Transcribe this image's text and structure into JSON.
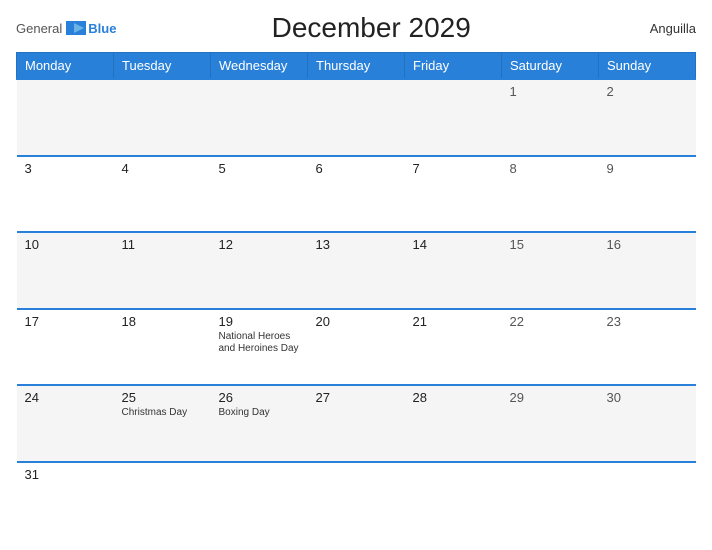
{
  "header": {
    "logo_general": "General",
    "logo_blue": "Blue",
    "title": "December 2029",
    "country": "Anguilla"
  },
  "columns": [
    "Monday",
    "Tuesday",
    "Wednesday",
    "Thursday",
    "Friday",
    "Saturday",
    "Sunday"
  ],
  "weeks": [
    [
      {
        "day": "",
        "holiday": ""
      },
      {
        "day": "",
        "holiday": ""
      },
      {
        "day": "",
        "holiday": ""
      },
      {
        "day": "",
        "holiday": ""
      },
      {
        "day": "",
        "holiday": ""
      },
      {
        "day": "1",
        "holiday": ""
      },
      {
        "day": "2",
        "holiday": ""
      }
    ],
    [
      {
        "day": "3",
        "holiday": ""
      },
      {
        "day": "4",
        "holiday": ""
      },
      {
        "day": "5",
        "holiday": ""
      },
      {
        "day": "6",
        "holiday": ""
      },
      {
        "day": "7",
        "holiday": ""
      },
      {
        "day": "8",
        "holiday": ""
      },
      {
        "day": "9",
        "holiday": ""
      }
    ],
    [
      {
        "day": "10",
        "holiday": ""
      },
      {
        "day": "11",
        "holiday": ""
      },
      {
        "day": "12",
        "holiday": ""
      },
      {
        "day": "13",
        "holiday": ""
      },
      {
        "day": "14",
        "holiday": ""
      },
      {
        "day": "15",
        "holiday": ""
      },
      {
        "day": "16",
        "holiday": ""
      }
    ],
    [
      {
        "day": "17",
        "holiday": ""
      },
      {
        "day": "18",
        "holiday": ""
      },
      {
        "day": "19",
        "holiday": "National Heroes and Heroines Day"
      },
      {
        "day": "20",
        "holiday": ""
      },
      {
        "day": "21",
        "holiday": ""
      },
      {
        "day": "22",
        "holiday": ""
      },
      {
        "day": "23",
        "holiday": ""
      }
    ],
    [
      {
        "day": "24",
        "holiday": ""
      },
      {
        "day": "25",
        "holiday": "Christmas Day"
      },
      {
        "day": "26",
        "holiday": "Boxing Day"
      },
      {
        "day": "27",
        "holiday": ""
      },
      {
        "day": "28",
        "holiday": ""
      },
      {
        "day": "29",
        "holiday": ""
      },
      {
        "day": "30",
        "holiday": ""
      }
    ],
    [
      {
        "day": "31",
        "holiday": ""
      },
      {
        "day": "",
        "holiday": ""
      },
      {
        "day": "",
        "holiday": ""
      },
      {
        "day": "",
        "holiday": ""
      },
      {
        "day": "",
        "holiday": ""
      },
      {
        "day": "",
        "holiday": ""
      },
      {
        "day": "",
        "holiday": ""
      }
    ]
  ]
}
